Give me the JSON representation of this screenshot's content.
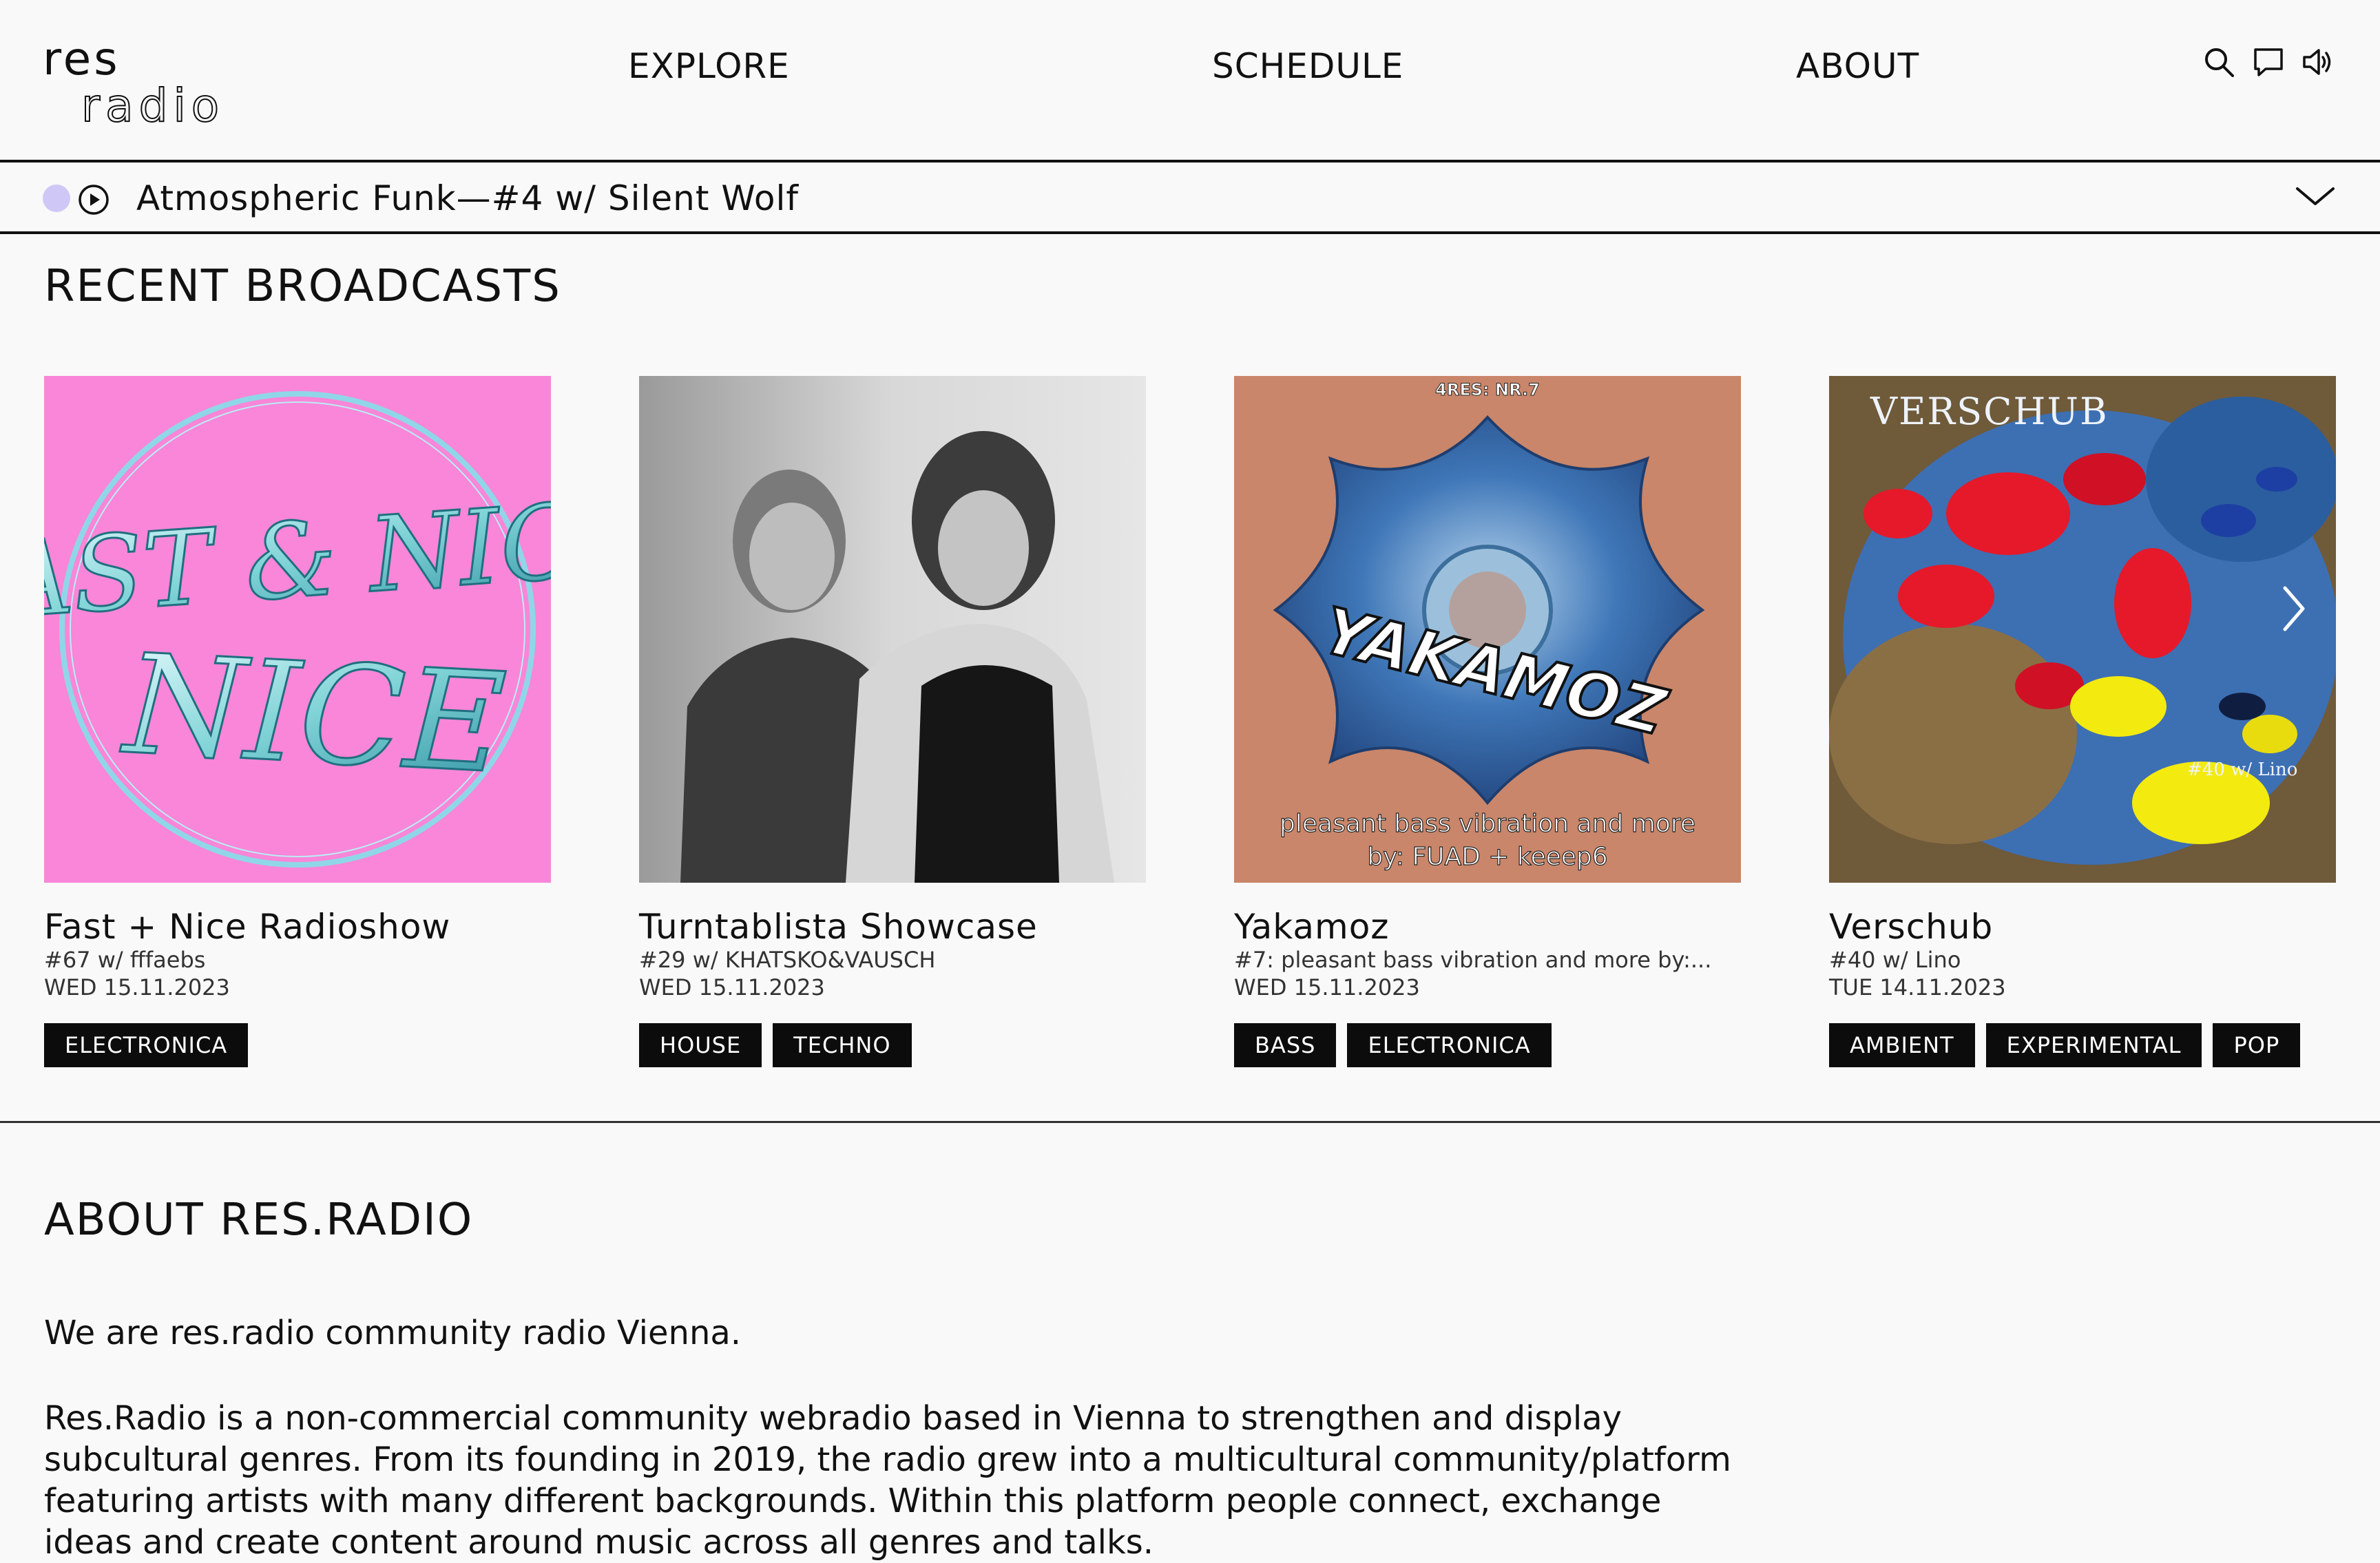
{
  "brand": {
    "line1": "res",
    "line2": "radio"
  },
  "nav": {
    "items": [
      {
        "label": "EXPLORE"
      },
      {
        "label": "SCHEDULE"
      },
      {
        "label": "ABOUT"
      }
    ],
    "icons": [
      "search-icon",
      "chat-icon",
      "volume-icon"
    ]
  },
  "player": {
    "now_playing": "Atmospheric Funk—#4 w/ Silent Wolf",
    "live_dot_color": "#cfc7f5"
  },
  "recent": {
    "title": "RECENT BROADCASTS",
    "cards": [
      {
        "title": "Fast + Nice Radioshow",
        "subtitle": "#67 w/ fffaebs",
        "date": "WED 15.11.2023",
        "tags": [
          "ELECTRONICA"
        ],
        "image_text": "FAST & NICE",
        "image_bg": "#f986d8"
      },
      {
        "title": "Turntablista Showcase",
        "subtitle": "#29 w/ KHATSKO&VAUSCH",
        "date": "WED 15.11.2023",
        "tags": [
          "HOUSE",
          "TECHNO"
        ],
        "image_bg": "#cfcfcf"
      },
      {
        "title": "Yakamoz",
        "subtitle": "#7: pleasant bass vibration and more by:...",
        "date": "WED 15.11.2023",
        "tags": [
          "BASS",
          "ELECTRONICA"
        ],
        "image_top": "4RES: NR.7",
        "image_logo": "YAKAMOZ",
        "image_caption_1": "pleasant bass vibration and more",
        "image_caption_2": "by: FUAD + keeep6",
        "image_bg": "#c9866a"
      },
      {
        "title": "Verschub",
        "subtitle": "#40 w/ Lino",
        "date": "TUE 14.11.2023",
        "tags": [
          "AMBIENT",
          "EXPERIMENTAL",
          "POP"
        ],
        "image_top": "VERSCHUB",
        "image_caption": "#40 w/ Lino",
        "image_bg": "#3d6fb3"
      }
    ]
  },
  "about": {
    "title": "ABOUT RES.RADIO",
    "intro": "We are res.radio community radio Vienna.",
    "body": "Res.Radio is a non-commercial community webradio based in Vienna to strengthen and display subcultural genres. From its founding in 2019, the radio grew into a multicultural community/platform featuring artists with many different backgrounds. Within this platform people connect, exchange ideas and create content around music across all genres and talks."
  }
}
